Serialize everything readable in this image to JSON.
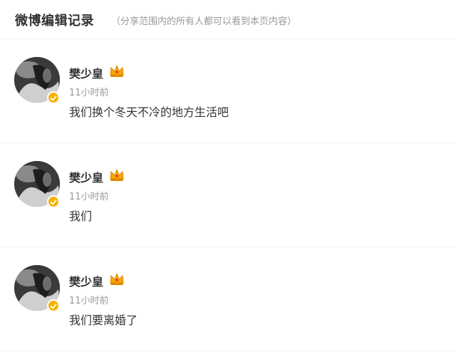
{
  "header": {
    "title": "微博编辑记录",
    "note": "（分享范围内的所有人都可以看到本页内容）"
  },
  "records": [
    {
      "username": "樊少皇",
      "badge_icon": "crown-icon",
      "verified_icon": "verified-icon",
      "timestamp": "11小时前",
      "content": "我们换个冬天不冷的地方生活吧"
    },
    {
      "username": "樊少皇",
      "badge_icon": "crown-icon",
      "verified_icon": "verified-icon",
      "timestamp": "11小时前",
      "content": "我们"
    },
    {
      "username": "樊少皇",
      "badge_icon": "crown-icon",
      "verified_icon": "verified-icon",
      "timestamp": "11小时前",
      "content": "我们要离婚了"
    }
  ],
  "colors": {
    "accent_verified": "#f6b400",
    "text_primary": "#333333",
    "text_secondary": "#999999",
    "divider": "#eeeeee"
  }
}
